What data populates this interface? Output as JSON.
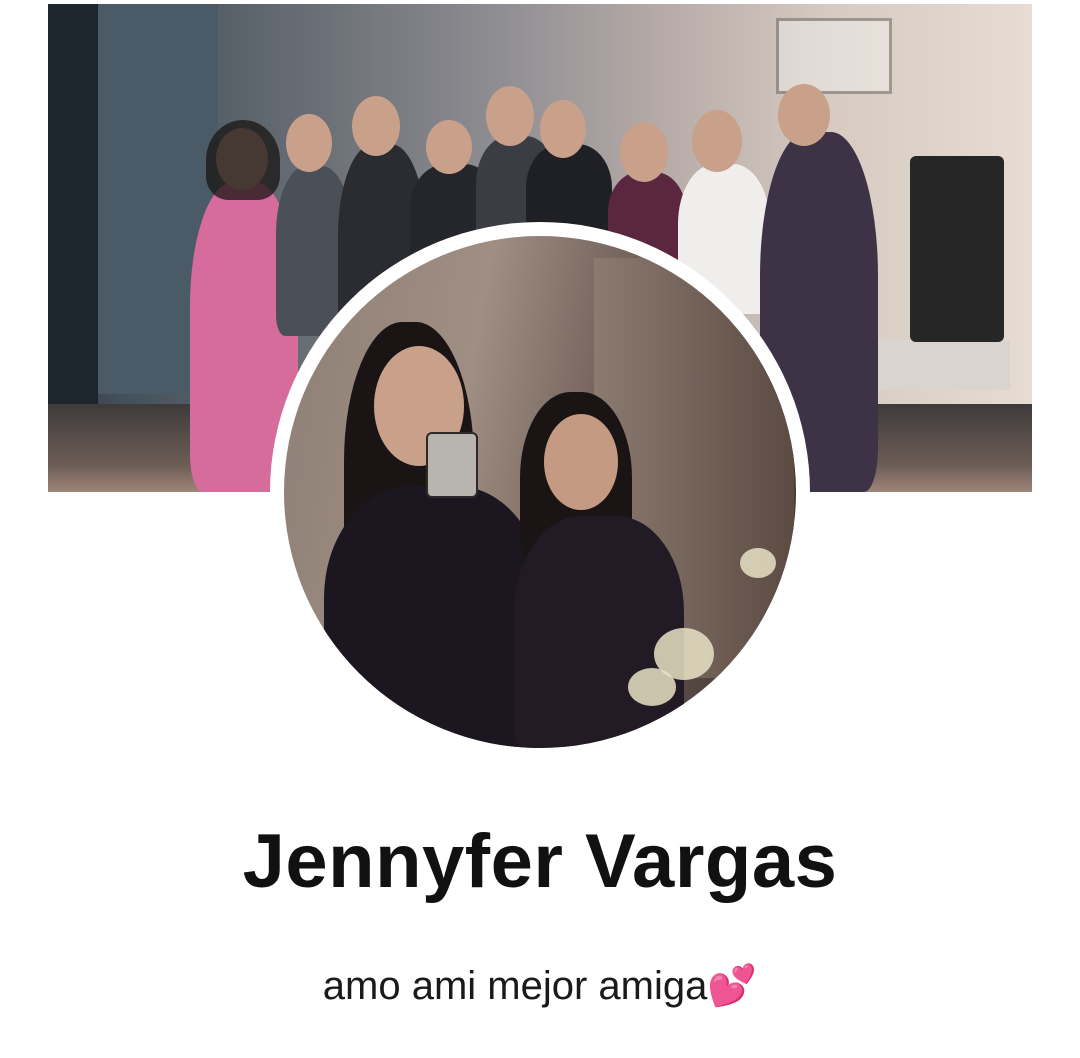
{
  "profile": {
    "name": "Jennyfer Vargas",
    "bio_text": "amo ami mejor amiga",
    "bio_emoji": "💕",
    "accent_color": "#e11d48"
  },
  "images": {
    "cover_photo": "group-photo",
    "profile_photo": "selfie-photo"
  }
}
